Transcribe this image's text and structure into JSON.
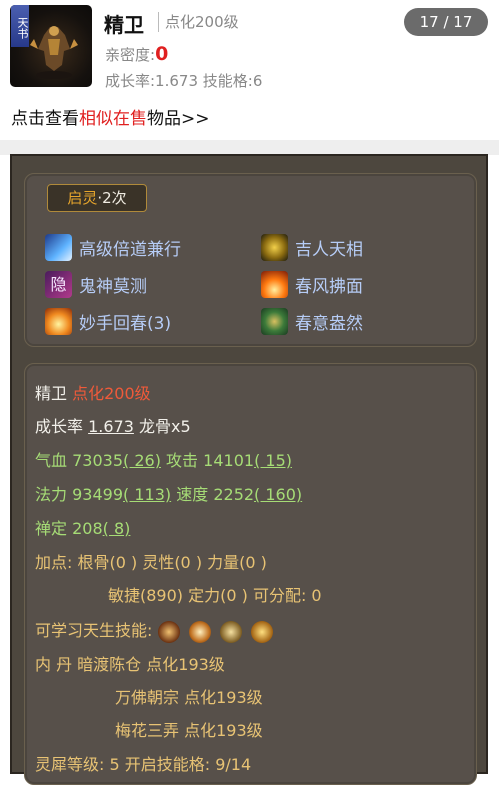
{
  "header": {
    "badge": "天书",
    "name": "精卫",
    "level": "点化200级",
    "pager": "17 / 17",
    "intimacy_label": "亲密度:",
    "intimacy_value": "0",
    "growth_line": "成长率:1.673  技能格:6",
    "similar_prefix": "点击查看",
    "similar_link": "相似在售",
    "similar_suffix": "物品>>"
  },
  "qiling": {
    "label": "启灵",
    "count": "·2次"
  },
  "skills": [
    {
      "label": "高级倍道兼行",
      "icon": "wing-icon"
    },
    {
      "label": "吉人天相",
      "icon": "golden-figure-icon"
    },
    {
      "label": "鬼神莫测",
      "icon": "hidden-glyph-icon"
    },
    {
      "label": "春风拂面",
      "icon": "flame-icon"
    },
    {
      "label": "妙手回春(3)",
      "icon": "fire-hand-icon"
    },
    {
      "label": "春意盎然",
      "icon": "green-nature-icon"
    }
  ],
  "detail": {
    "name": "精卫",
    "level": "点化200级",
    "growth_label": "成长率",
    "growth_value": "1.673",
    "dragon_bone": "龙骨x5",
    "hp_label": "气血",
    "hp_value": "73035",
    "hp_bonus": "( 26)",
    "atk_label": "攻击",
    "atk_value": "14101",
    "atk_bonus": "( 15)",
    "mp_label": "法力",
    "mp_value": "93499",
    "mp_bonus": "( 113)",
    "spd_label": "速度",
    "spd_value": "2252",
    "spd_bonus": "( 160)",
    "ding_label": "禅定",
    "ding_value": "208",
    "ding_bonus": "( 8)",
    "points1": "加点:  根骨(0 ) 灵性(0 ) 力量(0 )",
    "points2": "敏捷(890) 定力(0 ) 可分配:  0",
    "innate_label": "可学习天生技能:",
    "inner1": "内    丹  暗渡陈仓 点化193级",
    "inner2": "万佛朝宗 点化193级",
    "inner3": "梅花三弄 点化193级",
    "spirit": "灵犀等级:  5 开启技能格:  9/14"
  }
}
